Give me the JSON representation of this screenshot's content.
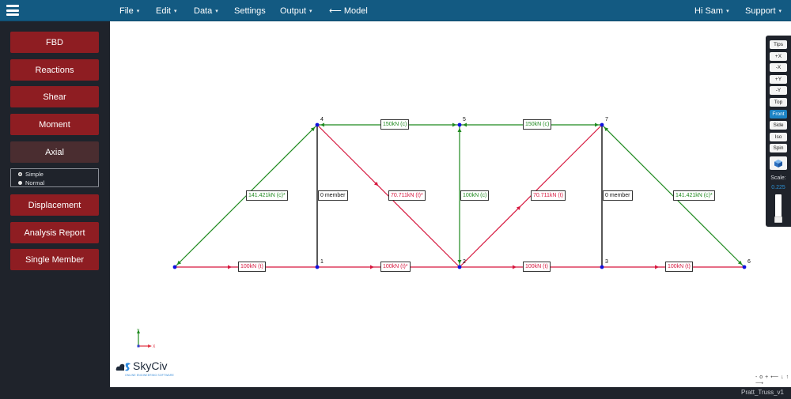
{
  "topbar": {
    "menu_icon": "hamburger-icon",
    "menus": [
      {
        "label": "File",
        "dropdown": true
      },
      {
        "label": "Edit",
        "dropdown": true
      },
      {
        "label": "Data",
        "dropdown": true
      },
      {
        "label": "Settings",
        "dropdown": false
      },
      {
        "label": "Output",
        "dropdown": true
      },
      {
        "label": "⟵ Model",
        "dropdown": false
      }
    ],
    "user": {
      "label": "Hi Sam",
      "dropdown": true
    },
    "support": {
      "label": "Support",
      "dropdown": true
    },
    "caret": "▾"
  },
  "sidebar": {
    "buttons": [
      {
        "label": "FBD"
      },
      {
        "label": "Reactions"
      },
      {
        "label": "Shear"
      },
      {
        "label": "Moment"
      },
      {
        "label": "Axial",
        "active": true
      },
      {
        "label": "Displacement"
      },
      {
        "label": "Analysis Report"
      },
      {
        "label": "Single Member"
      }
    ],
    "axial_options": [
      {
        "label": "Simple",
        "selected": true
      },
      {
        "label": "Normal",
        "selected": false
      }
    ]
  },
  "viewbar": {
    "buttons": [
      "Tips",
      "+X",
      "-X",
      "+Y",
      "-Y",
      "Top",
      "Front",
      "Side",
      "Iso",
      "Spin"
    ],
    "active": "Front",
    "cube_icon": "3d-cube-icon",
    "scale_label": "Scale:",
    "scale_value": "0.225"
  },
  "colors": {
    "compression": "#1f8a1f",
    "tension": "#d6163d",
    "zero": "#111111",
    "node": "#1010e0",
    "topbar": "#135a82",
    "sidebar_button": "#8e1d22"
  },
  "truss": {
    "nodes": [
      {
        "id": "0",
        "label": ""
      },
      {
        "id": "1",
        "label": "1"
      },
      {
        "id": "2",
        "label": "2"
      },
      {
        "id": "3",
        "label": "3"
      },
      {
        "id": "4",
        "label": "4"
      },
      {
        "id": "5",
        "label": "5"
      },
      {
        "id": "6",
        "label": "6"
      },
      {
        "id": "7",
        "label": "7"
      }
    ],
    "members": [
      {
        "from": "0",
        "to": "1",
        "type": "tension",
        "label": "100kN (t)"
      },
      {
        "from": "1",
        "to": "2",
        "type": "tension",
        "label": "100kN (t)*"
      },
      {
        "from": "2",
        "to": "3",
        "type": "tension",
        "label": "100kN (t)"
      },
      {
        "from": "3",
        "to": "6",
        "type": "tension",
        "label": "100kN (t)"
      },
      {
        "from": "0",
        "to": "4",
        "type": "compression",
        "label": "141.421kN (c)*"
      },
      {
        "from": "4",
        "to": "5",
        "type": "compression",
        "label": "150kN (c)"
      },
      {
        "from": "5",
        "to": "7",
        "type": "compression",
        "label": "150kN (c)"
      },
      {
        "from": "7",
        "to": "6",
        "type": "compression",
        "label": "141.421kN (c)*"
      },
      {
        "from": "1",
        "to": "4",
        "type": "zero",
        "label": "0 member"
      },
      {
        "from": "4",
        "to": "2",
        "type": "tension",
        "label": "70.711kN (t)*"
      },
      {
        "from": "5",
        "to": "2",
        "type": "compression",
        "label": "100kN (c)"
      },
      {
        "from": "2",
        "to": "7",
        "type": "tension",
        "label": "70.711kN (t)"
      },
      {
        "from": "3",
        "to": "7",
        "type": "zero",
        "label": "0 member"
      }
    ]
  },
  "axes": {
    "x": "X",
    "y": "Y"
  },
  "logo": {
    "name": "SkyCiv",
    "tagline": "ONLINE ENGINEERING SOFTWARE"
  },
  "nav_hint": "- o + ⟵ ↓ ↑ ⟶",
  "footer": {
    "project_name": "Pratt_Truss_v1"
  }
}
